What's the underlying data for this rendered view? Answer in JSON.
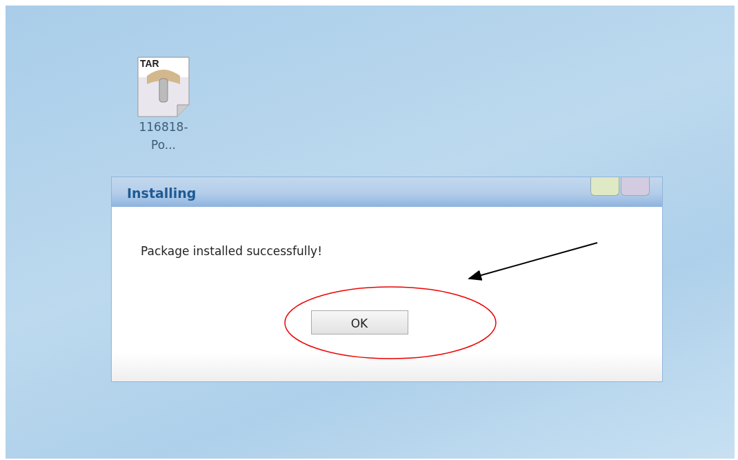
{
  "desktop_icons": [
    {
      "badge": "TAR",
      "label_lines": [
        "116818-",
        "Po..."
      ]
    }
  ],
  "dialog": {
    "title": "Installing",
    "message": "Package installed successfully!",
    "buttons": [
      "OK"
    ]
  }
}
